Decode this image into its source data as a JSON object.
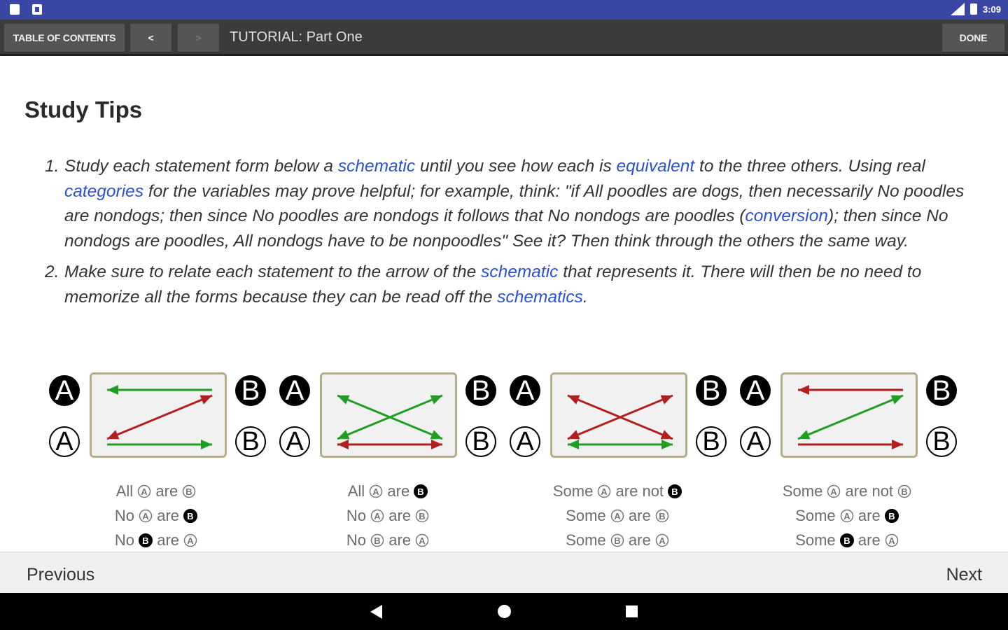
{
  "status_bar": {
    "time": "3:09"
  },
  "toolbar": {
    "toc_label": "TABLE OF CONTENTS",
    "back_label": "<",
    "forward_label": ">",
    "title": "TUTORIAL: Part One",
    "done_label": "DONE"
  },
  "page": {
    "title": "Study Tips",
    "tips": [
      {
        "number": "1.",
        "segments": [
          {
            "text": "Study each statement form below a ",
            "link": false
          },
          {
            "text": "schematic",
            "link": true
          },
          {
            "text": " until you see how each is ",
            "link": false
          },
          {
            "text": "equivalent",
            "link": true
          },
          {
            "text": " to the three others. Using real ",
            "link": false
          },
          {
            "text": "categories",
            "link": true
          },
          {
            "text": " for the variables may prove helpful; for example, think: \"if All poodles are dogs, then necessarily No poodles are nondogs; then since No poodles are nondogs it follows that No nondogs are poodles (",
            "link": false
          },
          {
            "text": "conversion",
            "link": true
          },
          {
            "text": "); then since No nondogs are poodles, All nondogs have to be nonpoodles\" See it? Then think through the others the same way.",
            "link": false
          }
        ]
      },
      {
        "number": "2.",
        "segments": [
          {
            "text": "Make sure to relate each statement to the arrow of the ",
            "link": false
          },
          {
            "text": "schematic",
            "link": true
          },
          {
            "text": " that represents it. There will then be no need to memorize all the forms because they can be read off the ",
            "link": false
          },
          {
            "text": "schematics",
            "link": true
          },
          {
            "text": ".",
            "link": false
          }
        ]
      }
    ]
  },
  "schematics": [
    {
      "labels": {
        "top_left": "A",
        "bottom_left": "A",
        "top_right": "B",
        "bottom_right": "B"
      },
      "arrows": [
        {
          "kind": "top-left",
          "color": "#1f9e22"
        },
        {
          "kind": "diag-up",
          "color": "#b21f1f"
        },
        {
          "kind": "bottom-right",
          "color": "#1f9e22"
        }
      ],
      "captions": [
        [
          {
            "t": "All "
          },
          {
            "c": "A",
            "o": true
          },
          {
            "t": " are "
          },
          {
            "c": "B",
            "o": true
          }
        ],
        [
          {
            "t": "No "
          },
          {
            "c": "A",
            "o": true
          },
          {
            "t": " are "
          },
          {
            "c": "B",
            "o": false
          }
        ],
        [
          {
            "t": "No "
          },
          {
            "c": "B",
            "o": false
          },
          {
            "t": " are "
          },
          {
            "c": "A",
            "o": true
          }
        ]
      ]
    },
    {
      "labels": {
        "top_left": "A",
        "bottom_left": "A",
        "top_right": "B",
        "bottom_right": "B"
      },
      "arrows": [
        {
          "kind": "diag-down",
          "color": "#1f9e22"
        },
        {
          "kind": "diag-up",
          "color": "#1f9e22"
        },
        {
          "kind": "bottom-both",
          "color": "#b21f1f"
        }
      ],
      "captions": [
        [
          {
            "t": "All "
          },
          {
            "c": "A",
            "o": true
          },
          {
            "t": " are "
          },
          {
            "c": "B",
            "o": false
          }
        ],
        [
          {
            "t": "No "
          },
          {
            "c": "A",
            "o": true
          },
          {
            "t": " are "
          },
          {
            "c": "B",
            "o": true
          }
        ],
        [
          {
            "t": "No "
          },
          {
            "c": "B",
            "o": true
          },
          {
            "t": " are "
          },
          {
            "c": "A",
            "o": true
          }
        ]
      ]
    },
    {
      "labels": {
        "top_left": "A",
        "bottom_left": "A",
        "top_right": "B",
        "bottom_right": "B"
      },
      "arrows": [
        {
          "kind": "diag-down",
          "color": "#b21f1f"
        },
        {
          "kind": "diag-up",
          "color": "#b21f1f"
        },
        {
          "kind": "bottom-both",
          "color": "#1f9e22"
        }
      ],
      "captions": [
        [
          {
            "t": "Some "
          },
          {
            "c": "A",
            "o": true
          },
          {
            "t": " are not "
          },
          {
            "c": "B",
            "o": false
          }
        ],
        [
          {
            "t": "Some "
          },
          {
            "c": "A",
            "o": true
          },
          {
            "t": " are "
          },
          {
            "c": "B",
            "o": true
          }
        ],
        [
          {
            "t": "Some "
          },
          {
            "c": "B",
            "o": true
          },
          {
            "t": " are "
          },
          {
            "c": "A",
            "o": true
          }
        ]
      ]
    },
    {
      "labels": {
        "top_left": "A",
        "bottom_left": "A",
        "top_right": "B",
        "bottom_right": "B"
      },
      "arrows": [
        {
          "kind": "top-left",
          "color": "#b21f1f"
        },
        {
          "kind": "diag-up",
          "color": "#1f9e22"
        },
        {
          "kind": "bottom-right",
          "color": "#b21f1f"
        }
      ],
      "captions": [
        [
          {
            "t": "Some "
          },
          {
            "c": "A",
            "o": true
          },
          {
            "t": " are not "
          },
          {
            "c": "B",
            "o": true
          }
        ],
        [
          {
            "t": "Some "
          },
          {
            "c": "A",
            "o": true
          },
          {
            "t": " are "
          },
          {
            "c": "B",
            "o": false
          }
        ],
        [
          {
            "t": "Some "
          },
          {
            "c": "B",
            "o": false
          },
          {
            "t": " are "
          },
          {
            "c": "A",
            "o": true
          }
        ]
      ]
    }
  ],
  "bottom_nav": {
    "previous_label": "Previous",
    "next_label": "Next"
  },
  "icons": {
    "status_left": [
      "sim-card-icon",
      "notification-icon"
    ],
    "status_right": [
      "signal-icon",
      "battery-icon"
    ],
    "system_nav": [
      "back-icon",
      "home-icon",
      "recents-icon"
    ]
  },
  "colors": {
    "status_bar": "#3a46a3",
    "toolbar": "#3b3b3b",
    "link": "#2c4fd8",
    "green_arrow": "#1f9e22",
    "red_arrow": "#b21f1f"
  }
}
